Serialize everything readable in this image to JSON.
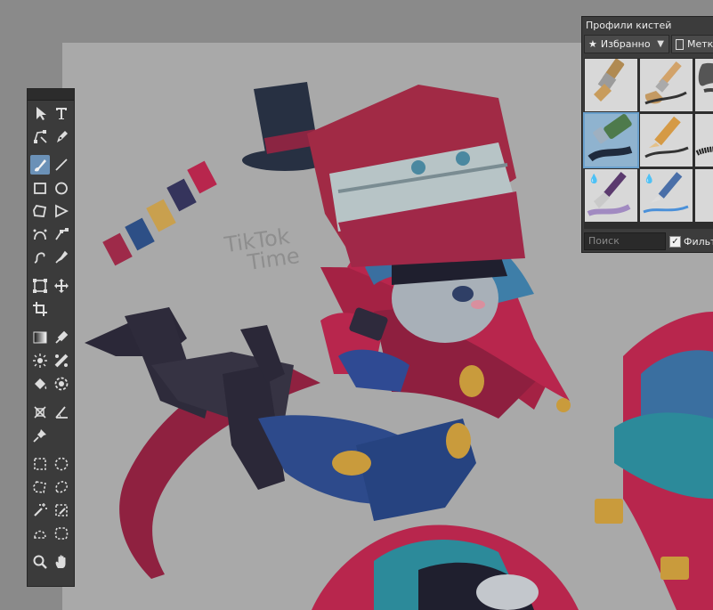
{
  "canvas": {
    "watermark_line1": "TikTok",
    "watermark_line2": "Time",
    "palette_colors": [
      "#9e2a49",
      "#2d4f86",
      "#c9a04e",
      "#35345c",
      "#b8264d"
    ]
  },
  "toolbox": {
    "tools": [
      {
        "name": "move-tool",
        "icon": "arrow-cursor-icon"
      },
      {
        "name": "text-tool",
        "icon": "text-icon",
        "glyph": "T"
      },
      {
        "name": "node-edit-tool",
        "icon": "node-edit-icon"
      },
      {
        "name": "pen-tool",
        "icon": "pen-nib-icon"
      },
      {
        "name": "brush-tool",
        "icon": "brush-icon",
        "active": true
      },
      {
        "name": "line-tool",
        "icon": "line-icon"
      },
      {
        "name": "rectangle-tool",
        "icon": "rectangle-icon"
      },
      {
        "name": "ellipse-tool",
        "icon": "ellipse-icon"
      },
      {
        "name": "polygon-tool",
        "icon": "polygon-icon"
      },
      {
        "name": "polyline-tool",
        "icon": "polyline-icon"
      },
      {
        "name": "bezier-tool",
        "icon": "bezier-icon"
      },
      {
        "name": "path-tool",
        "icon": "path-icon"
      },
      {
        "name": "freehand-path-tool",
        "icon": "freehand-path-icon"
      },
      {
        "name": "dynamic-brush-tool",
        "icon": "rocket-brush-icon"
      },
      {
        "name": "transform-tool",
        "icon": "transform-icon"
      },
      {
        "name": "pan-move-tool",
        "icon": "move-cross-icon"
      },
      {
        "name": "crop-tool",
        "icon": "crop-icon"
      },
      {
        "name": "gradient-tool",
        "icon": "gradient-icon"
      },
      {
        "name": "eyedropper-tool",
        "icon": "eyedropper-icon"
      },
      {
        "name": "smart-patch-tool",
        "icon": "smart-patch-icon"
      },
      {
        "name": "colorize-tool",
        "icon": "colorize-icon"
      },
      {
        "name": "fill-tool",
        "icon": "paint-bucket-icon"
      },
      {
        "name": "enclose-fill-tool",
        "icon": "enclose-fill-icon"
      },
      {
        "name": "assistant-tool",
        "icon": "assistant-icon"
      },
      {
        "name": "measure-tool",
        "icon": "measure-angle-icon"
      },
      {
        "name": "reference-images-tool",
        "icon": "pin-icon"
      },
      {
        "name": "rect-select-tool",
        "icon": "rect-select-icon"
      },
      {
        "name": "ellipse-select-tool",
        "icon": "ellipse-select-icon"
      },
      {
        "name": "polygon-select-tool",
        "icon": "polygon-select-icon"
      },
      {
        "name": "freehand-select-tool",
        "icon": "freehand-select-icon"
      },
      {
        "name": "magic-wand-tool",
        "icon": "magic-wand-icon"
      },
      {
        "name": "similar-select-tool",
        "icon": "similar-select-icon"
      },
      {
        "name": "bezier-select-tool",
        "icon": "bezier-select-icon"
      },
      {
        "name": "magnetic-select-tool",
        "icon": "magnetic-select-icon"
      },
      {
        "name": "zoom-tool",
        "icon": "zoom-icon"
      },
      {
        "name": "hand-tool",
        "icon": "hand-icon"
      }
    ]
  },
  "brush_panel": {
    "title": "Профили кистей",
    "favorites_label": "Избранно",
    "tags_label": "Метк",
    "search_placeholder": "Поиск",
    "filter_label": "Фильт",
    "filter_checked": "✓",
    "presets": [
      {
        "name": "brush-preset-1",
        "icon": "flat-brush-icon"
      },
      {
        "name": "brush-preset-2",
        "icon": "round-brush-icon"
      },
      {
        "name": "brush-preset-3",
        "icon": "smudge-icon"
      },
      {
        "name": "brush-preset-4",
        "icon": "eraser-icon",
        "selected": true
      },
      {
        "name": "brush-preset-5",
        "icon": "pencil-icon"
      },
      {
        "name": "brush-preset-6",
        "icon": "charcoal-icon"
      },
      {
        "name": "brush-preset-7",
        "icon": "watercolor-brush-icon"
      },
      {
        "name": "brush-preset-8",
        "icon": "ink-pen-icon"
      },
      {
        "name": "brush-preset-9",
        "icon": "wet-brush-icon"
      }
    ]
  }
}
